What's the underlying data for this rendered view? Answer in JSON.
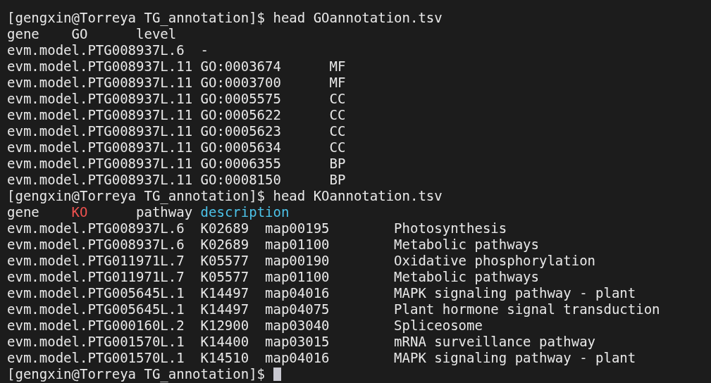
{
  "terminal": {
    "lines": [
      {
        "segments": [
          {
            "text": "[gengxin@Torreya TG_annotation]$ head GOannotation.tsv"
          }
        ]
      },
      {
        "segments": [
          {
            "text": "gene    GO      level"
          }
        ]
      },
      {
        "segments": [
          {
            "text": "evm.model.PTG008937L.6  -"
          }
        ]
      },
      {
        "segments": [
          {
            "text": "evm.model.PTG008937L.11 GO:0003674      MF"
          }
        ]
      },
      {
        "segments": [
          {
            "text": "evm.model.PTG008937L.11 GO:0003700      MF"
          }
        ]
      },
      {
        "segments": [
          {
            "text": "evm.model.PTG008937L.11 GO:0005575      CC"
          }
        ]
      },
      {
        "segments": [
          {
            "text": "evm.model.PTG008937L.11 GO:0005622      CC"
          }
        ]
      },
      {
        "segments": [
          {
            "text": "evm.model.PTG008937L.11 GO:0005623      CC"
          }
        ]
      },
      {
        "segments": [
          {
            "text": "evm.model.PTG008937L.11 GO:0005634      CC"
          }
        ]
      },
      {
        "segments": [
          {
            "text": "evm.model.PTG008937L.11 GO:0006355      BP"
          }
        ]
      },
      {
        "segments": [
          {
            "text": "evm.model.PTG008937L.11 GO:0008150      BP"
          }
        ]
      },
      {
        "segments": [
          {
            "text": "[gengxin@Torreya TG_annotation]$ head KOannotation.tsv"
          }
        ]
      },
      {
        "segments": [
          {
            "text": "gene    "
          },
          {
            "text": "KO",
            "color": "#f0524f"
          },
          {
            "text": "      pathway "
          },
          {
            "text": "description",
            "color": "#4cc2e8"
          }
        ]
      },
      {
        "segments": [
          {
            "text": "evm.model.PTG008937L.6  K02689  map00195        Photosynthesis"
          }
        ]
      },
      {
        "segments": [
          {
            "text": "evm.model.PTG008937L.6  K02689  map01100        Metabolic pathways"
          }
        ]
      },
      {
        "segments": [
          {
            "text": "evm.model.PTG011971L.7  K05577  map00190        Oxidative phosphorylation"
          }
        ]
      },
      {
        "segments": [
          {
            "text": "evm.model.PTG011971L.7  K05577  map01100        Metabolic pathways"
          }
        ]
      },
      {
        "segments": [
          {
            "text": "evm.model.PTG005645L.1  K14497  map04016        MAPK signaling pathway - plant"
          }
        ]
      },
      {
        "segments": [
          {
            "text": "evm.model.PTG005645L.1  K14497  map04075        Plant hormone signal transduction"
          }
        ]
      },
      {
        "segments": [
          {
            "text": "evm.model.PTG000160L.2  K12900  map03040        Spliceosome"
          }
        ]
      },
      {
        "segments": [
          {
            "text": "evm.model.PTG001570L.1  K14400  map03015        mRNA surveillance pathway"
          }
        ]
      },
      {
        "segments": [
          {
            "text": "evm.model.PTG001570L.1  K14510  map04016        MAPK signaling pathway - plant"
          }
        ]
      },
      {
        "segments": [
          {
            "text": "[gengxin@Torreya TG_annotation]$ "
          }
        ]
      }
    ],
    "cursor": true
  }
}
